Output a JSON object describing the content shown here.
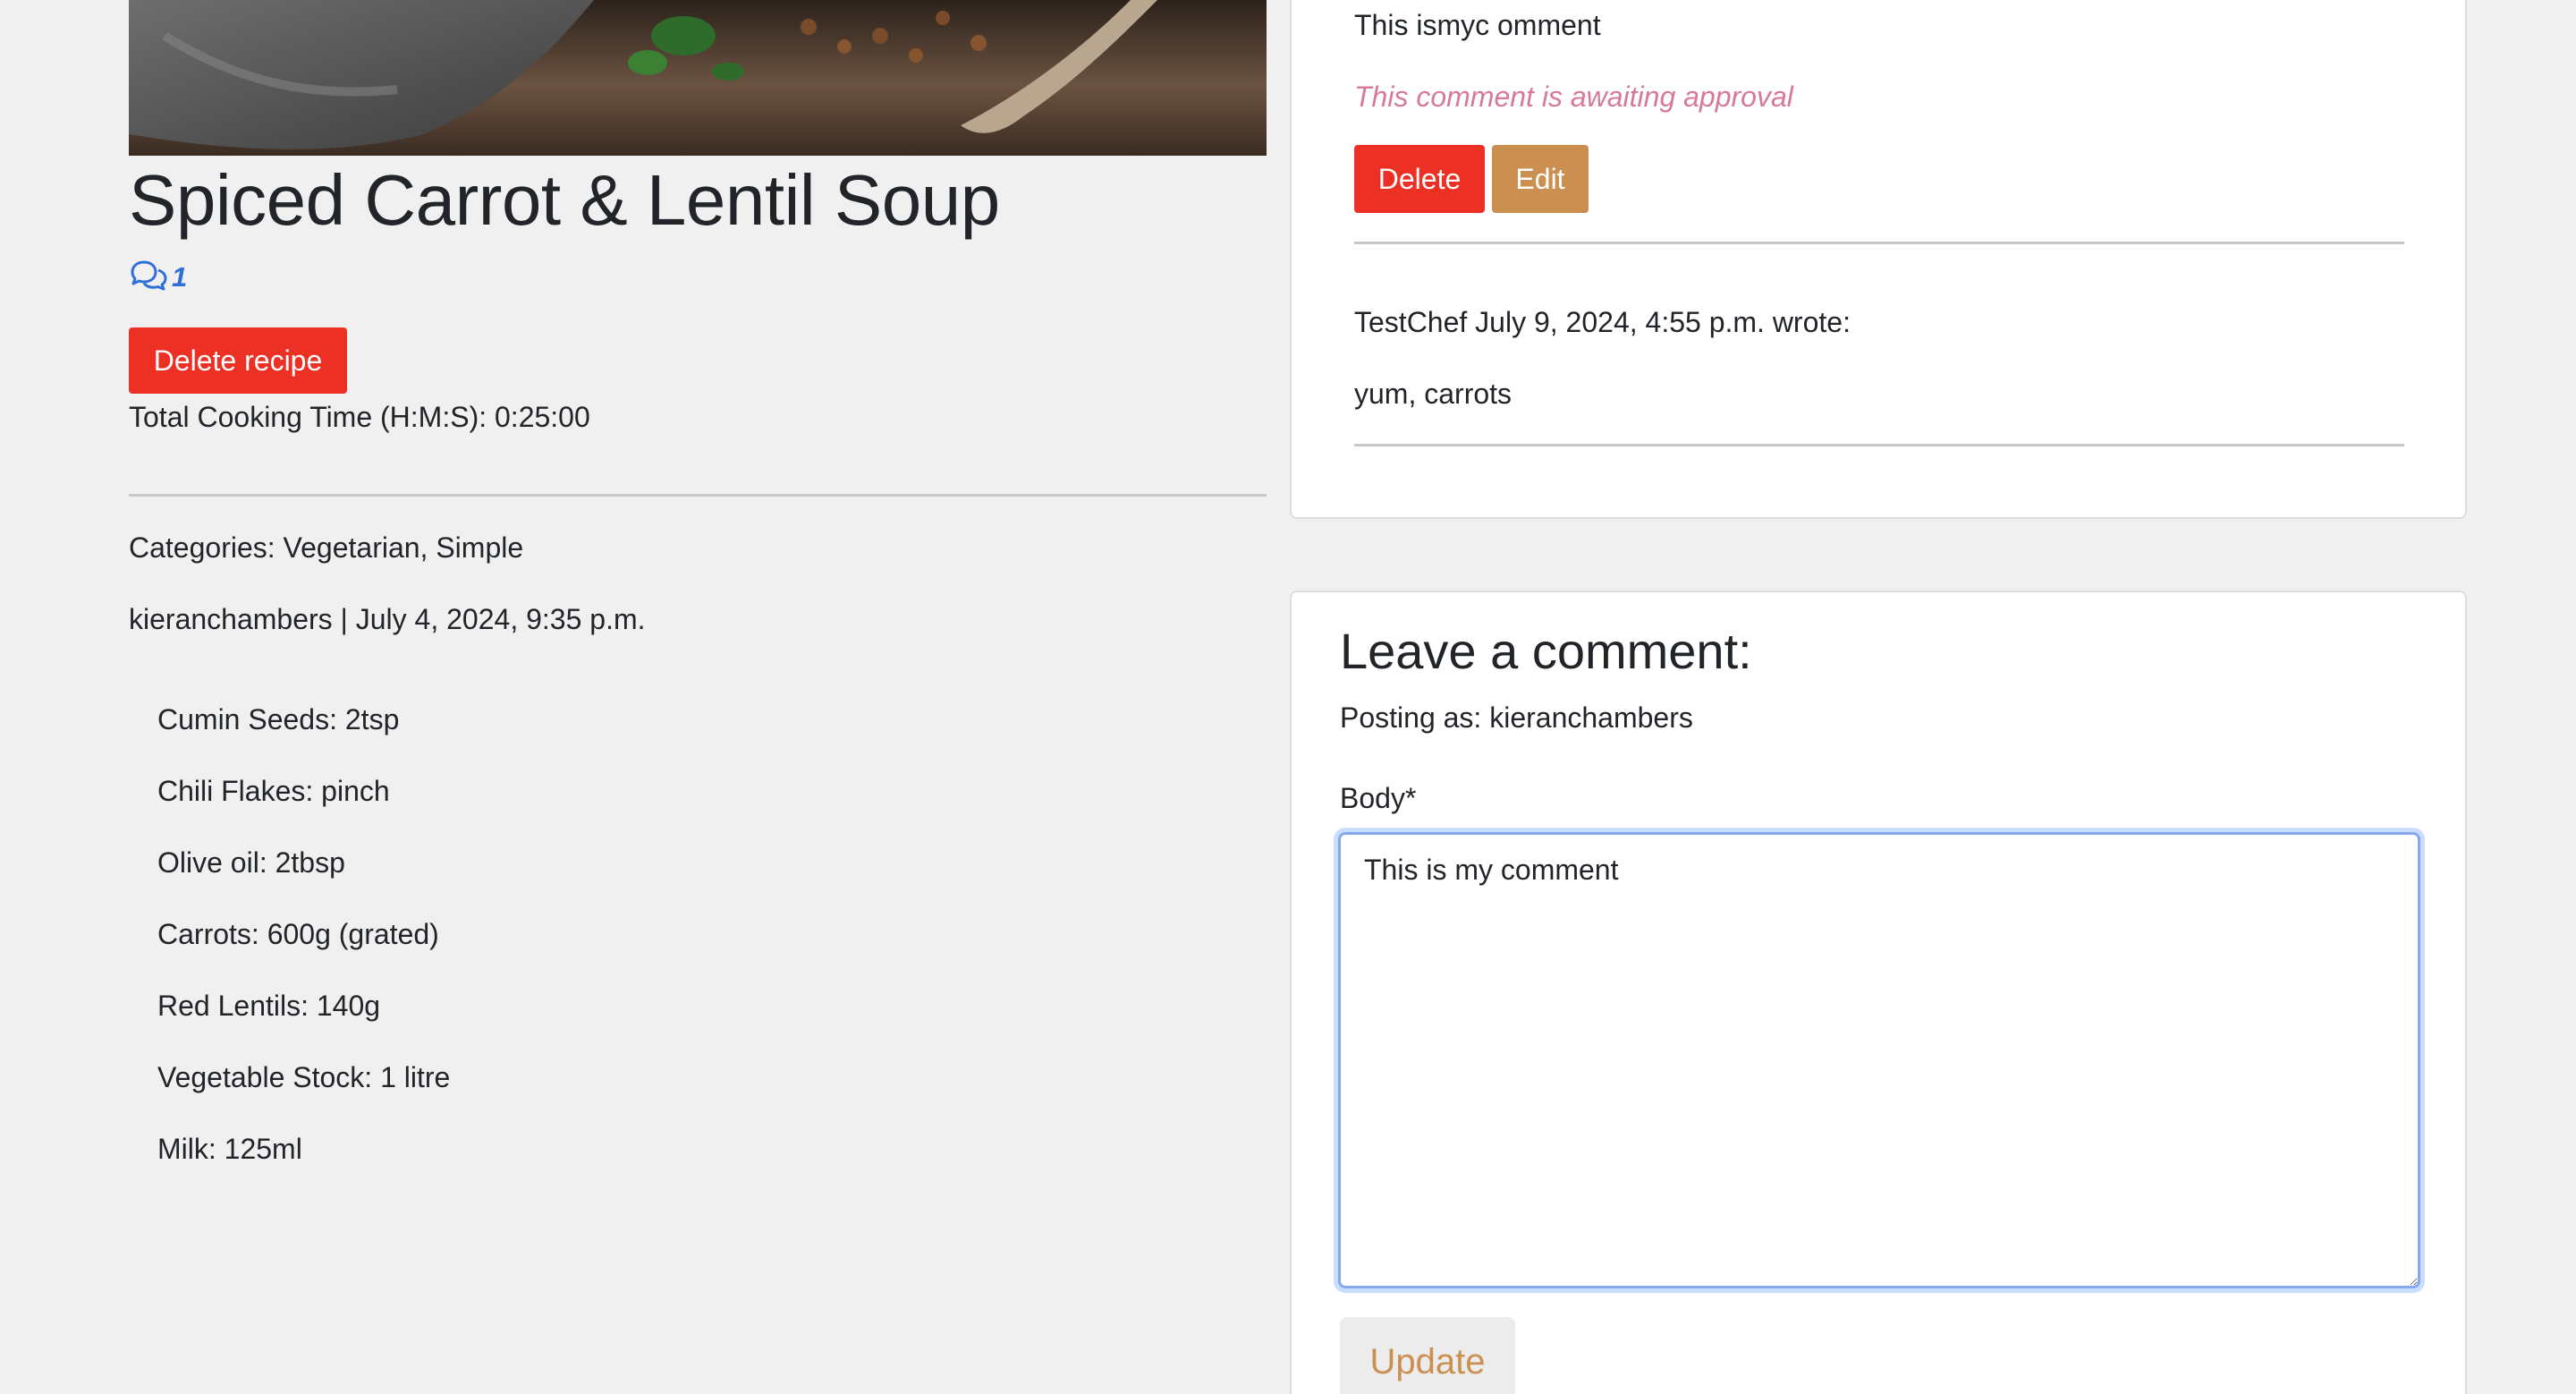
{
  "recipe": {
    "title": "Spiced Carrot & Lentil Soup",
    "comment_count": "1",
    "delete_label": "Delete recipe",
    "cooking_time": "Total Cooking Time (H:M:S): 0:25:00",
    "categories": "Categories: Vegetarian, Simple",
    "byline": "kieranchambers | July 4, 2024, 9:35 p.m.",
    "ingredients": [
      "Cumin Seeds: 2tsp",
      "Chili Flakes: pinch",
      "Olive oil: 2tbsp",
      "Carrots: 600g (grated)",
      "Red Lentils: 140g",
      "Vegetable Stock: 1 litre",
      "Milk: 125ml"
    ]
  },
  "comments": [
    {
      "body": "This ismyc omment",
      "status": "This comment is awaiting approval",
      "delete_label": "Delete",
      "edit_label": "Edit"
    },
    {
      "meta": "TestChef July 9, 2024, 4:55 p.m. wrote:",
      "body": "yum, carrots"
    }
  ],
  "comment_form": {
    "heading": "Leave a comment:",
    "posting_as": "Posting as: kieranchambers",
    "body_label": "Body*",
    "body_value": "This is my comment",
    "submit_label": "Update"
  },
  "colors": {
    "danger": "#ec3124",
    "accent": "#cb9050",
    "link": "#2f6fd9",
    "awaiting": "#d77a99",
    "background": "#f0f0f0"
  },
  "icons": {
    "comment_count": "comments-icon"
  }
}
